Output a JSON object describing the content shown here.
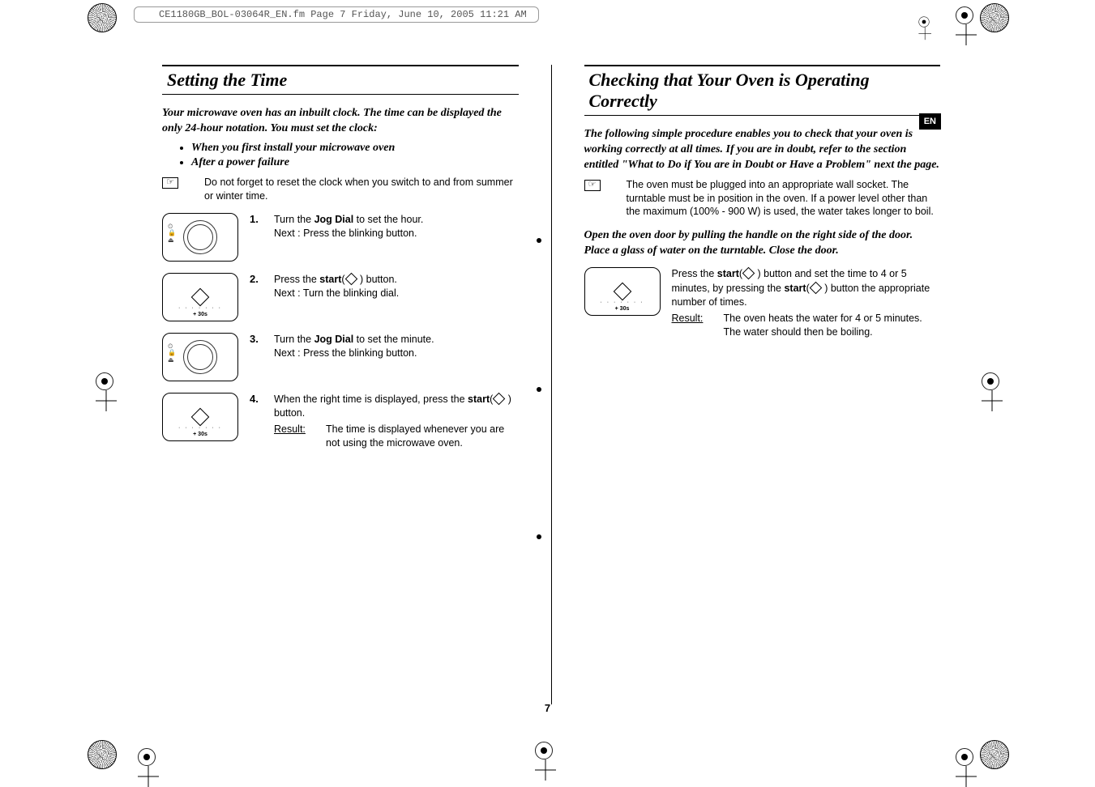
{
  "header_line": "CE1180GB_BOL-03064R_EN.fm  Page 7  Friday, June 10, 2005  11:21 AM",
  "lang_tab": "EN",
  "page_number": "7",
  "left": {
    "title": "Setting the Time",
    "intro": "Your microwave oven has an inbuilt clock. The time can be displayed the only 24-hour notation. You must set the clock:",
    "bullets": [
      "When you first install your microwave oven",
      "After a power failure"
    ],
    "note": "Do not forget to reset the clock when you switch to and from summer or winter time.",
    "steps": [
      {
        "num": "1.",
        "text_a": "Turn the ",
        "bold_a": "Jog Dial",
        "text_b": " to set the hour.",
        "line2": "Next : Press the blinking button."
      },
      {
        "num": "2.",
        "text_a": "Press the  ",
        "bold_a": "start",
        "text_b": "(",
        "text_c": " ) button.",
        "line2": "Next : Turn the blinking dial."
      },
      {
        "num": "3.",
        "text_a": "Turn the ",
        "bold_a": "Jog Dial",
        "text_b": " to set the minute.",
        "line2": "Next : Press the blinking button."
      },
      {
        "num": "4.",
        "text_a": "When the right time is displayed, press the ",
        "bold_a": "start",
        "text_b": "(",
        "text_c": " ) button.",
        "result_label": "Result:",
        "result_text": "The time is displayed whenever you are not using the microwave oven."
      }
    ],
    "plus30": "+ 30s"
  },
  "right": {
    "title": "Checking that Your Oven is Operating Correctly",
    "intro": "The following simple procedure enables you to check that your oven is working correctly at all times. If you are in doubt, refer to the section entitled \"What to Do if You are in Doubt or Have a Problem\" next  the page.",
    "note": "The oven must be plugged into an appropriate wall socket. The turntable must be in position in the oven. If a power level other than the maximum (100% - 900 W) is used, the water takes longer to boil.",
    "instruction": "Open the oven door by pulling the handle on the right side of the door. Place a glass of water on the turntable. Close the door.",
    "step": {
      "text_a": "Press the ",
      "bold_a": "start",
      "text_b": "(",
      "text_c": " ) button and set the time to 4 or 5 minutes, by pressing the ",
      "bold_b": "start",
      "text_d": "(",
      "text_e": " ) button the appropriate number of times.",
      "result_label": "Result:",
      "result_text": "The oven heats the water for 4 or 5 minutes. The water should then be boiling."
    },
    "plus30": "+ 30s"
  }
}
